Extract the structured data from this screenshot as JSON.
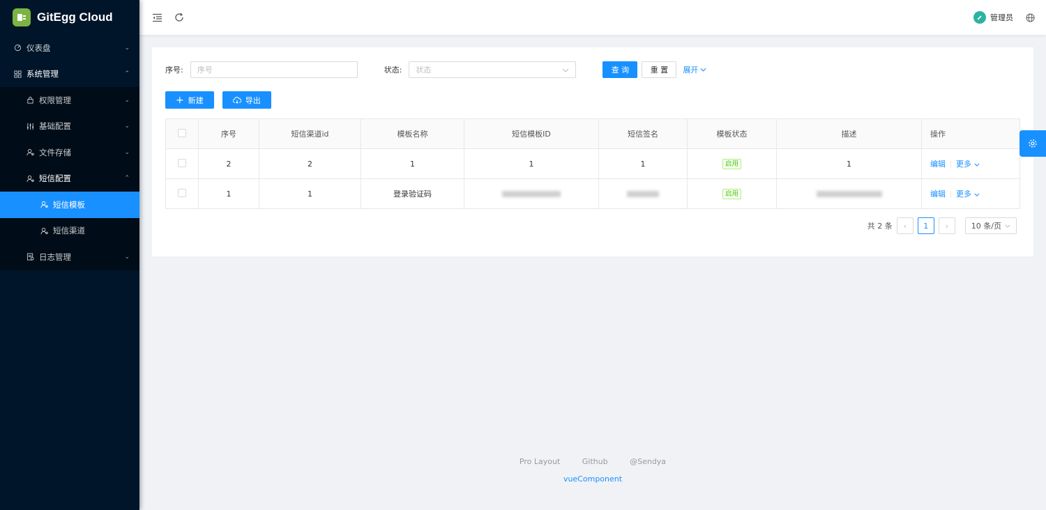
{
  "app": {
    "title": "GitEgg Cloud"
  },
  "sidebar": {
    "items": [
      {
        "label": "仪表盘",
        "icon": "dashboard-icon"
      },
      {
        "label": "系统管理",
        "icon": "system-icon"
      },
      {
        "label": "权限管理",
        "icon": "lock-icon"
      },
      {
        "label": "基础配置",
        "icon": "sliders-icon"
      },
      {
        "label": "文件存储",
        "icon": "user-cog-icon"
      },
      {
        "label": "短信配置",
        "icon": "user-cog-icon"
      },
      {
        "label": "短信模板",
        "icon": "user-cog-icon"
      },
      {
        "label": "短信渠道",
        "icon": "user-cog-icon"
      },
      {
        "label": "日志管理",
        "icon": "log-icon"
      }
    ]
  },
  "header": {
    "user_name": "管理员"
  },
  "search": {
    "serial_label": "序号:",
    "serial_placeholder": "序号",
    "status_label": "状态:",
    "status_placeholder": "状态",
    "query_label": "查 询",
    "reset_label": "重 置",
    "expand_label": "展开"
  },
  "toolbar": {
    "new_label": "新建",
    "export_label": "导出"
  },
  "table": {
    "columns": [
      "序号",
      "短信渠道id",
      "模板名称",
      "短信模板ID",
      "短信签名",
      "模板状态",
      "描述",
      "操作"
    ],
    "rows": [
      {
        "serial": "2",
        "channel_id": "2",
        "template_name": "1",
        "template_id": "1",
        "signature": "1",
        "status": "启用",
        "description": "1",
        "edit": "编辑",
        "more": "更多"
      },
      {
        "serial": "1",
        "channel_id": "1",
        "template_name": "登录验证码",
        "template_id": "",
        "signature": "",
        "status": "启用",
        "description": "",
        "edit": "编辑",
        "more": "更多"
      }
    ]
  },
  "pagination": {
    "total_text": "共 2 条",
    "current_page": "1",
    "page_size": "10 条/页"
  },
  "footer": {
    "links": [
      "Pro Layout",
      "Github",
      "@Sendya"
    ],
    "sub": "vueComponent"
  },
  "colors": {
    "sidebar_bg": "#001529",
    "primary": "#1890ff",
    "status_green": "#52c41a"
  }
}
